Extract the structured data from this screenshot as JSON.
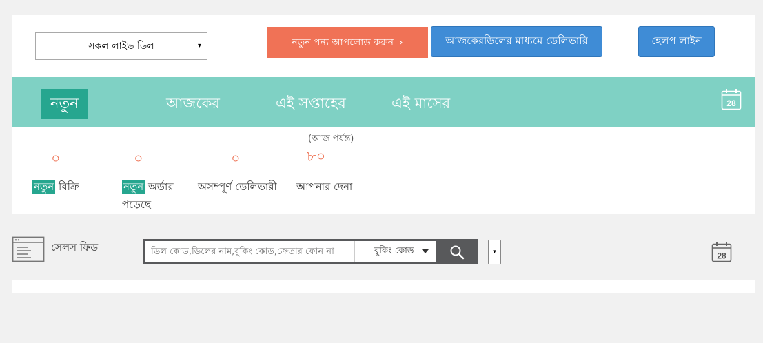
{
  "header": {
    "deal_select": {
      "value": "সকল লাইভ ডিল",
      "caret": "▾"
    },
    "upload_button": {
      "label": "নতুন পন্য আপলোড করুন",
      "chevron": "›"
    },
    "delivery_button": {
      "label": "আজকেরডিলের মাধ্যমে ডেলিভারি"
    },
    "help_button": {
      "label": "হেলপ লাইন"
    }
  },
  "tabs": [
    {
      "label": "নতুন",
      "active": true
    },
    {
      "label": "আজকের",
      "active": false
    },
    {
      "label": "এই সপ্তাহের",
      "active": false
    },
    {
      "label": "এই মাসের",
      "active": false
    }
  ],
  "calendar_icon": {
    "name": "calendar-icon",
    "day": "28"
  },
  "stats": [
    {
      "value": "০",
      "label_highlight": "নতুন",
      "label_rest": " বিক্রি"
    },
    {
      "value": "০",
      "label_highlight": "নতুন",
      "label_rest": " অর্ডার পড়েছে"
    },
    {
      "value": "০",
      "label_highlight": "",
      "label_rest": "অসম্পূর্ণ ডেলিভারী"
    },
    {
      "value": "৮০",
      "sub_label": "(আজ পর্যন্ত)",
      "label_highlight": "",
      "label_rest": "আপনার দেনা"
    }
  ],
  "sales_feed": {
    "title": "সেলস ফিড",
    "search_placeholder": "ডিল কোড,ডিলের নাম,বুকিং কোড,ক্রেতার ফোন না",
    "search_type": "বুকিং কোড",
    "small_dropdown_caret": "▾"
  },
  "colors": {
    "accent_teal": "#7fd1c4",
    "active_tab": "#26a68f",
    "upload_orange": "#f07256",
    "button_blue": "#3f8cd6",
    "stat_orange": "#ee7355"
  }
}
